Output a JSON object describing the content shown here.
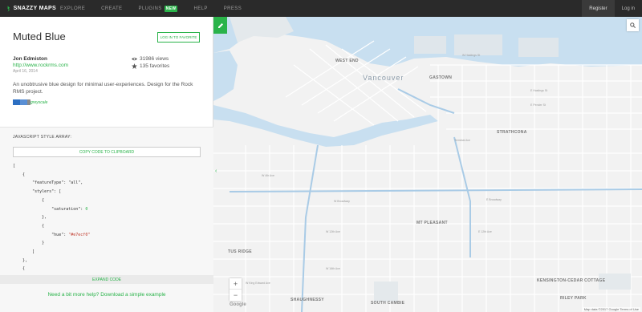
{
  "brand": {
    "name": "SNAZZY MAPS"
  },
  "nav": {
    "items": [
      "EXPLORE",
      "CREATE",
      "PLUGINS",
      "HELP",
      "PRESS"
    ],
    "plugins_badge": "NEW"
  },
  "auth": {
    "register": "Register",
    "login": "Log in"
  },
  "style": {
    "title": "Muted Blue",
    "favorite_button": "LOG IN TO FAVORITE",
    "author": "Jon Edmiston",
    "author_url": "http://www.rockrms.com",
    "date": "April 16, 2014",
    "views": "31986 views",
    "favorites": "135 favorites",
    "description": "An unobtrusive blue design for minimal user-experiences. Design for the Rock RMS project.",
    "tag": "greyscale",
    "swatch_colors": [
      "#2c6fc2",
      "#5a8fd4",
      "#8a8a8a"
    ]
  },
  "code_section": {
    "label": "JAVASCRIPT STYLE ARRAY:",
    "copy_button": "COPY CODE TO CLIPBOARD",
    "expand": "EXPAND CODE",
    "help": "Need a bit more help? Download a simple example"
  },
  "map": {
    "labels": {
      "vancouver": "Vancouver",
      "west_end": "WEST END",
      "gastown": "GASTOWN",
      "strathcona": "STRATHCONA",
      "mt_pleasant": "MT PLEASANT",
      "kensington": "KENSINGTON-CEDAR COTTAGE",
      "shaughnessy": "SHAUGHNESSY",
      "south_cambie": "SOUTH CAMBIE",
      "riley": "RILEY PARK",
      "tus_ridge": "TUS RIDGE"
    },
    "streets": {
      "w_hastings": "W Hastings St",
      "e_hastings": "E Hastings St",
      "e_pender": "E Pender St",
      "terminal": "Terminal Ave",
      "e_broadway": "E Broadway",
      "w_broadway": "W Broadway",
      "w_12th": "W 12th Ave",
      "w_16th": "W 16th Ave",
      "e_12th": "E 12th Ave",
      "w_4th": "W 4th Ave",
      "w_king_edward": "W King Edward Ave"
    },
    "attribution": "Map data ©2017 Google  Terms of Use",
    "google": "Google",
    "zoom_in": "+",
    "zoom_out": "−",
    "colors": {
      "background": "#f2f2f2",
      "water": "#c8dff0",
      "road": "#ffffff",
      "accent": "#2ab34a"
    }
  }
}
